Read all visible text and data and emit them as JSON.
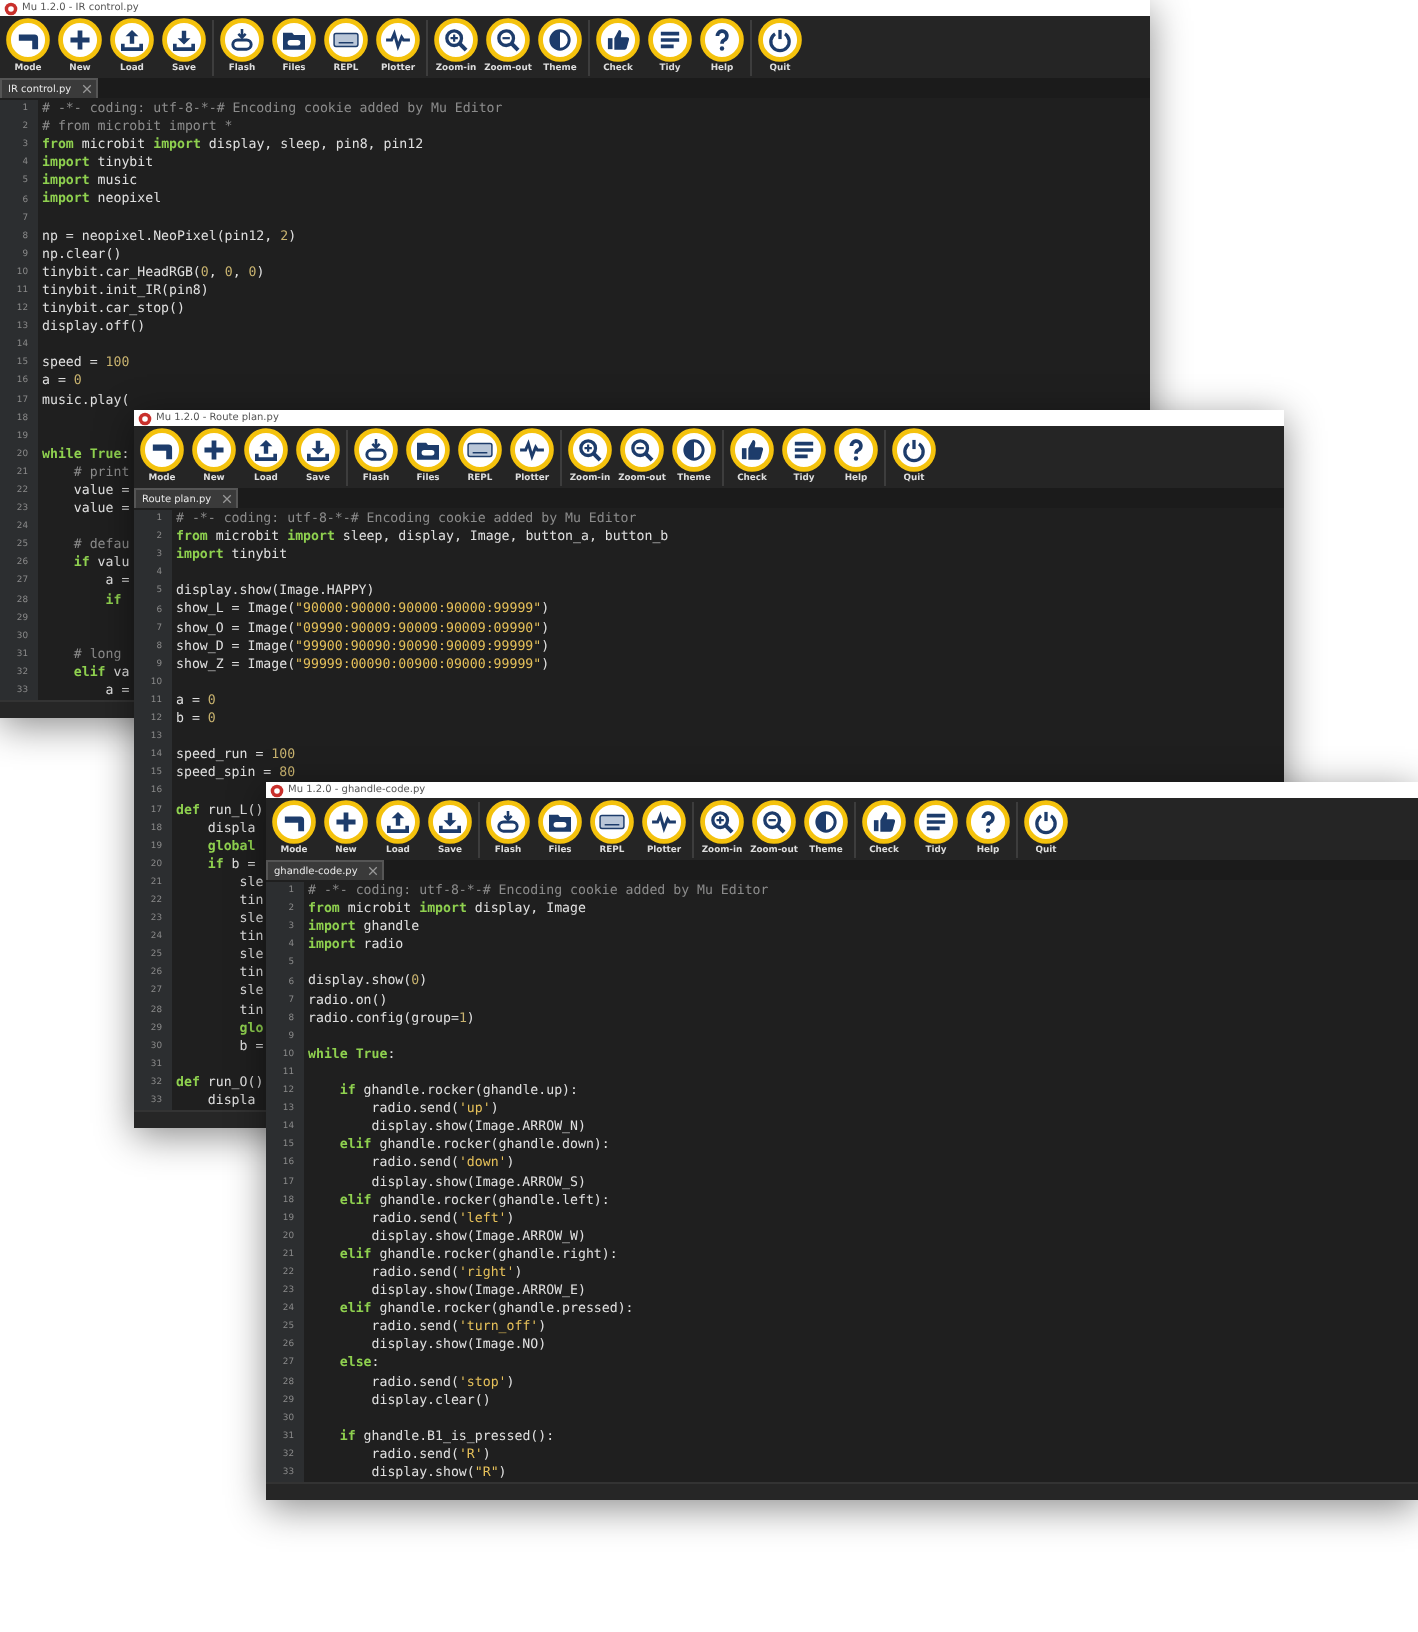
{
  "windows": [
    {
      "title": "Mu 1.2.0 - IR control.py",
      "toolbar_groups": [
        [
          "Mode",
          "New",
          "Load",
          "Save"
        ],
        [
          "Flash",
          "Files",
          "REPL",
          "Plotter"
        ],
        [
          "Zoom-in",
          "Zoom-out",
          "Theme"
        ],
        [
          "Check",
          "Tidy",
          "Help"
        ],
        [
          "Quit"
        ]
      ],
      "tab": {
        "label": "IR control.py"
      },
      "lines": [
        {
          "number": "1",
          "segments": [
            {
              "kind": "comment",
              "text": "# -*- coding: utf-8-*-# Encoding cookie added by Mu Editor"
            }
          ]
        },
        {
          "number": "2",
          "segments": [
            {
              "kind": "comment",
              "text": "# from microbit import *"
            }
          ]
        },
        {
          "number": "3",
          "segments": [
            {
              "kind": "keyword",
              "text": "from"
            },
            {
              "kind": "plain",
              "text": " microbit "
            },
            {
              "kind": "keyword",
              "text": "import"
            },
            {
              "kind": "plain",
              "text": " display, sleep, pin8, pin12"
            }
          ]
        },
        {
          "number": "4",
          "segments": [
            {
              "kind": "keyword",
              "text": "import"
            },
            {
              "kind": "plain",
              "text": " tinybit"
            }
          ]
        },
        {
          "number": "5",
          "segments": [
            {
              "kind": "keyword",
              "text": "import"
            },
            {
              "kind": "plain",
              "text": " music"
            }
          ]
        },
        {
          "number": "6",
          "segments": [
            {
              "kind": "keyword",
              "text": "import"
            },
            {
              "kind": "plain",
              "text": " neopixel"
            }
          ]
        },
        {
          "number": "7"
        },
        {
          "number": "8",
          "segments": [
            {
              "kind": "plain",
              "text": "np = neopixel.NeoPixel(pin12, "
            },
            {
              "kind": "number",
              "text": "2"
            },
            {
              "kind": "plain",
              "text": ")"
            }
          ]
        },
        {
          "number": "9",
          "segments": [
            {
              "kind": "plain",
              "text": "np.clear()"
            }
          ]
        },
        {
          "number": "10",
          "segments": [
            {
              "kind": "plain",
              "text": "tinybit.car_HeadRGB("
            },
            {
              "kind": "number",
              "text": "0"
            },
            {
              "kind": "plain",
              "text": ", "
            },
            {
              "kind": "number",
              "text": "0"
            },
            {
              "kind": "plain",
              "text": ", "
            },
            {
              "kind": "number",
              "text": "0"
            },
            {
              "kind": "plain",
              "text": ")"
            }
          ]
        },
        {
          "number": "11",
          "segments": [
            {
              "kind": "plain",
              "text": "tinybit.init_IR(pin8)"
            }
          ]
        },
        {
          "number": "12",
          "segments": [
            {
              "kind": "plain",
              "text": "tinybit.car_stop()"
            }
          ]
        },
        {
          "number": "13",
          "segments": [
            {
              "kind": "plain",
              "text": "display.off()"
            }
          ]
        },
        {
          "number": "14"
        },
        {
          "number": "15",
          "segments": [
            {
              "kind": "plain",
              "text": "speed = "
            },
            {
              "kind": "number",
              "text": "100"
            }
          ]
        },
        {
          "number": "16",
          "segments": [
            {
              "kind": "plain",
              "text": "a = "
            },
            {
              "kind": "number",
              "text": "0"
            }
          ]
        },
        {
          "number": "17",
          "segments": [
            {
              "kind": "plain",
              "text": "music.play("
            }
          ]
        },
        {
          "number": "18"
        },
        {
          "number": "19"
        },
        {
          "number": "20",
          "segments": [
            {
              "kind": "keyword",
              "text": "while True"
            },
            {
              "kind": "plain",
              "text": ":"
            }
          ]
        },
        {
          "number": "21",
          "segments": [
            {
              "kind": "comment",
              "text": "    # print"
            }
          ]
        },
        {
          "number": "22",
          "segments": [
            {
              "kind": "plain",
              "text": "    value ="
            }
          ]
        },
        {
          "number": "23",
          "segments": [
            {
              "kind": "plain",
              "text": "    value ="
            }
          ]
        },
        {
          "number": "24"
        },
        {
          "number": "25",
          "segments": [
            {
              "kind": "comment",
              "text": "    # defau"
            }
          ]
        },
        {
          "number": "26",
          "segments": [
            {
              "kind": "keyword",
              "text": "    if"
            },
            {
              "kind": "plain",
              "text": " valu"
            }
          ]
        },
        {
          "number": "27",
          "segments": [
            {
              "kind": "plain",
              "text": "        a ="
            }
          ]
        },
        {
          "number": "28",
          "segments": [
            {
              "kind": "keyword",
              "text": "        if"
            }
          ]
        },
        {
          "number": "29"
        },
        {
          "number": "30"
        },
        {
          "number": "31",
          "segments": [
            {
              "kind": "comment",
              "text": "    # long"
            }
          ]
        },
        {
          "number": "32",
          "segments": [
            {
              "kind": "keyword",
              "text": "    elif"
            },
            {
              "kind": "plain",
              "text": " va"
            }
          ]
        },
        {
          "number": "33",
          "segments": [
            {
              "kind": "plain",
              "text": "        a ="
            }
          ]
        }
      ]
    },
    {
      "title": "Mu 1.2.0 - Route plan.py",
      "toolbar_groups": [
        [
          "Mode",
          "New",
          "Load",
          "Save"
        ],
        [
          "Flash",
          "Files",
          "REPL",
          "Plotter"
        ],
        [
          "Zoom-in",
          "Zoom-out",
          "Theme"
        ],
        [
          "Check",
          "Tidy",
          "Help"
        ],
        [
          "Quit"
        ]
      ],
      "tab": {
        "label": "Route plan.py"
      },
      "lines": [
        {
          "number": "1",
          "segments": [
            {
              "kind": "comment",
              "text": "# -*- coding: utf-8-*-# Encoding cookie added by Mu Editor"
            }
          ]
        },
        {
          "number": "2",
          "segments": [
            {
              "kind": "keyword",
              "text": "from"
            },
            {
              "kind": "plain",
              "text": " microbit "
            },
            {
              "kind": "keyword",
              "text": "import"
            },
            {
              "kind": "plain",
              "text": " sleep, display, Image, button_a, button_b"
            }
          ]
        },
        {
          "number": "3",
          "segments": [
            {
              "kind": "keyword",
              "text": "import"
            },
            {
              "kind": "plain",
              "text": " tinybit"
            }
          ]
        },
        {
          "number": "4"
        },
        {
          "number": "5",
          "segments": [
            {
              "kind": "plain",
              "text": "display.show(Image.HAPPY)"
            }
          ]
        },
        {
          "number": "6",
          "segments": [
            {
              "kind": "plain",
              "text": "show_L = Image("
            },
            {
              "kind": "string",
              "text": "\"90000:90000:90000:90000:99999\""
            },
            {
              "kind": "plain",
              "text": ")"
            }
          ]
        },
        {
          "number": "7",
          "segments": [
            {
              "kind": "plain",
              "text": "show_O = Image("
            },
            {
              "kind": "string",
              "text": "\"09990:90009:90009:90009:09990\""
            },
            {
              "kind": "plain",
              "text": ")"
            }
          ]
        },
        {
          "number": "8",
          "segments": [
            {
              "kind": "plain",
              "text": "show_D = Image("
            },
            {
              "kind": "string",
              "text": "\"99900:90090:90090:90009:99999\""
            },
            {
              "kind": "plain",
              "text": ")"
            }
          ]
        },
        {
          "number": "9",
          "segments": [
            {
              "kind": "plain",
              "text": "show_Z = Image("
            },
            {
              "kind": "string",
              "text": "\"99999:00090:00900:09000:99999\""
            },
            {
              "kind": "plain",
              "text": ")"
            }
          ]
        },
        {
          "number": "10"
        },
        {
          "number": "11",
          "segments": [
            {
              "kind": "plain",
              "text": "a = "
            },
            {
              "kind": "number",
              "text": "0"
            }
          ]
        },
        {
          "number": "12",
          "segments": [
            {
              "kind": "plain",
              "text": "b = "
            },
            {
              "kind": "number",
              "text": "0"
            }
          ]
        },
        {
          "number": "13"
        },
        {
          "number": "14",
          "segments": [
            {
              "kind": "plain",
              "text": "speed_run = "
            },
            {
              "kind": "number",
              "text": "100"
            }
          ]
        },
        {
          "number": "15",
          "segments": [
            {
              "kind": "plain",
              "text": "speed_spin = "
            },
            {
              "kind": "number",
              "text": "80"
            }
          ]
        },
        {
          "number": "16"
        },
        {
          "number": "17",
          "segments": [
            {
              "kind": "keyword",
              "text": "def"
            },
            {
              "kind": "plain",
              "text": " run_L()"
            }
          ]
        },
        {
          "number": "18",
          "segments": [
            {
              "kind": "plain",
              "text": "    displa"
            }
          ]
        },
        {
          "number": "19",
          "segments": [
            {
              "kind": "keyword",
              "text": "    global"
            }
          ]
        },
        {
          "number": "20",
          "segments": [
            {
              "kind": "keyword",
              "text": "    if"
            },
            {
              "kind": "plain",
              "text": " b ="
            }
          ]
        },
        {
          "number": "21",
          "segments": [
            {
              "kind": "plain",
              "text": "        sle"
            }
          ]
        },
        {
          "number": "22",
          "segments": [
            {
              "kind": "plain",
              "text": "        tin"
            }
          ]
        },
        {
          "number": "23",
          "segments": [
            {
              "kind": "plain",
              "text": "        sle"
            }
          ]
        },
        {
          "number": "24",
          "segments": [
            {
              "kind": "plain",
              "text": "        tin"
            }
          ]
        },
        {
          "number": "25",
          "segments": [
            {
              "kind": "plain",
              "text": "        sle"
            }
          ]
        },
        {
          "number": "26",
          "segments": [
            {
              "kind": "plain",
              "text": "        tin"
            }
          ]
        },
        {
          "number": "27",
          "segments": [
            {
              "kind": "plain",
              "text": "        sle"
            }
          ]
        },
        {
          "number": "28",
          "segments": [
            {
              "kind": "plain",
              "text": "        tin"
            }
          ]
        },
        {
          "number": "29",
          "segments": [
            {
              "kind": "keyword",
              "text": "        glo"
            }
          ]
        },
        {
          "number": "30",
          "segments": [
            {
              "kind": "plain",
              "text": "        b ="
            }
          ]
        },
        {
          "number": "31"
        },
        {
          "number": "32",
          "segments": [
            {
              "kind": "keyword",
              "text": "def"
            },
            {
              "kind": "plain",
              "text": " run_O()"
            }
          ]
        },
        {
          "number": "33",
          "segments": [
            {
              "kind": "plain",
              "text": "    displa"
            }
          ]
        }
      ]
    },
    {
      "title": "Mu 1.2.0 - ghandle-code.py",
      "toolbar_groups": [
        [
          "Mode",
          "New",
          "Load",
          "Save"
        ],
        [
          "Flash",
          "Files",
          "REPL",
          "Plotter"
        ],
        [
          "Zoom-in",
          "Zoom-out",
          "Theme"
        ],
        [
          "Check",
          "Tidy",
          "Help"
        ],
        [
          "Quit"
        ]
      ],
      "tab": {
        "label": "ghandle-code.py"
      },
      "lines": [
        {
          "number": "1",
          "segments": [
            {
              "kind": "comment",
              "text": "# -*- coding: utf-8-*-# Encoding cookie added by Mu Editor"
            }
          ]
        },
        {
          "number": "2",
          "segments": [
            {
              "kind": "keyword",
              "text": "from"
            },
            {
              "kind": "plain",
              "text": " microbit "
            },
            {
              "kind": "keyword",
              "text": "import"
            },
            {
              "kind": "plain",
              "text": " display, Image"
            }
          ]
        },
        {
          "number": "3",
          "segments": [
            {
              "kind": "keyword",
              "text": "import"
            },
            {
              "kind": "plain",
              "text": " ghandle"
            }
          ]
        },
        {
          "number": "4",
          "segments": [
            {
              "kind": "keyword",
              "text": "import"
            },
            {
              "kind": "plain",
              "text": " radio"
            }
          ]
        },
        {
          "number": "5"
        },
        {
          "number": "6",
          "segments": [
            {
              "kind": "plain",
              "text": "display.show("
            },
            {
              "kind": "number",
              "text": "0"
            },
            {
              "kind": "plain",
              "text": ")"
            }
          ]
        },
        {
          "number": "7",
          "segments": [
            {
              "kind": "plain",
              "text": "radio.on()"
            }
          ]
        },
        {
          "number": "8",
          "segments": [
            {
              "kind": "plain",
              "text": "radio.config(group="
            },
            {
              "kind": "number",
              "text": "1"
            },
            {
              "kind": "plain",
              "text": ")"
            }
          ]
        },
        {
          "number": "9"
        },
        {
          "number": "10",
          "segments": [
            {
              "kind": "keyword",
              "text": "while True"
            },
            {
              "kind": "plain",
              "text": ":"
            }
          ]
        },
        {
          "number": "11"
        },
        {
          "number": "12",
          "segments": [
            {
              "kind": "keyword",
              "text": "    if"
            },
            {
              "kind": "plain",
              "text": " ghandle.rocker(ghandle.up):"
            }
          ]
        },
        {
          "number": "13",
          "segments": [
            {
              "kind": "plain",
              "text": "        radio.send("
            },
            {
              "kind": "string",
              "text": "'up'"
            },
            {
              "kind": "plain",
              "text": ")"
            }
          ]
        },
        {
          "number": "14",
          "segments": [
            {
              "kind": "plain",
              "text": "        display.show(Image.ARROW_N)"
            }
          ]
        },
        {
          "number": "15",
          "segments": [
            {
              "kind": "keyword",
              "text": "    elif"
            },
            {
              "kind": "plain",
              "text": " ghandle.rocker(ghandle.down):"
            }
          ]
        },
        {
          "number": "16",
          "segments": [
            {
              "kind": "plain",
              "text": "        radio.send("
            },
            {
              "kind": "string",
              "text": "'down'"
            },
            {
              "kind": "plain",
              "text": ")"
            }
          ]
        },
        {
          "number": "17",
          "segments": [
            {
              "kind": "plain",
              "text": "        display.show(Image.ARROW_S)"
            }
          ]
        },
        {
          "number": "18",
          "segments": [
            {
              "kind": "keyword",
              "text": "    elif"
            },
            {
              "kind": "plain",
              "text": " ghandle.rocker(ghandle.left):"
            }
          ]
        },
        {
          "number": "19",
          "segments": [
            {
              "kind": "plain",
              "text": "        radio.send("
            },
            {
              "kind": "string",
              "text": "'left'"
            },
            {
              "kind": "plain",
              "text": ")"
            }
          ]
        },
        {
          "number": "20",
          "segments": [
            {
              "kind": "plain",
              "text": "        display.show(Image.ARROW_W)"
            }
          ]
        },
        {
          "number": "21",
          "segments": [
            {
              "kind": "keyword",
              "text": "    elif"
            },
            {
              "kind": "plain",
              "text": " ghandle.rocker(ghandle.right):"
            }
          ]
        },
        {
          "number": "22",
          "segments": [
            {
              "kind": "plain",
              "text": "        radio.send("
            },
            {
              "kind": "string",
              "text": "'right'"
            },
            {
              "kind": "plain",
              "text": ")"
            }
          ]
        },
        {
          "number": "23",
          "segments": [
            {
              "kind": "plain",
              "text": "        display.show(Image.ARROW_E)"
            }
          ]
        },
        {
          "number": "24",
          "segments": [
            {
              "kind": "keyword",
              "text": "    elif"
            },
            {
              "kind": "plain",
              "text": " ghandle.rocker(ghandle.pressed):"
            }
          ]
        },
        {
          "number": "25",
          "segments": [
            {
              "kind": "plain",
              "text": "        radio.send("
            },
            {
              "kind": "string",
              "text": "'turn_off'"
            },
            {
              "kind": "plain",
              "text": ")"
            }
          ]
        },
        {
          "number": "26",
          "segments": [
            {
              "kind": "plain",
              "text": "        display.show(Image.NO)"
            }
          ]
        },
        {
          "number": "27",
          "segments": [
            {
              "kind": "keyword",
              "text": "    else"
            },
            {
              "kind": "plain",
              "text": ":"
            }
          ]
        },
        {
          "number": "28",
          "segments": [
            {
              "kind": "plain",
              "text": "        radio.send("
            },
            {
              "kind": "string",
              "text": "'stop'"
            },
            {
              "kind": "plain",
              "text": ")"
            }
          ]
        },
        {
          "number": "29",
          "segments": [
            {
              "kind": "plain",
              "text": "        display.clear()"
            }
          ]
        },
        {
          "number": "30"
        },
        {
          "number": "31",
          "segments": [
            {
              "kind": "keyword",
              "text": "    if"
            },
            {
              "kind": "plain",
              "text": " ghandle.B1_is_pressed():"
            }
          ]
        },
        {
          "number": "32",
          "segments": [
            {
              "kind": "plain",
              "text": "        radio.send("
            },
            {
              "kind": "string",
              "text": "'R'"
            },
            {
              "kind": "plain",
              "text": ")"
            }
          ]
        },
        {
          "number": "33",
          "segments": [
            {
              "kind": "plain",
              "text": "        display.show("
            },
            {
              "kind": "string",
              "text": "\"R\""
            },
            {
              "kind": "plain",
              "text": ")"
            }
          ]
        }
      ]
    }
  ]
}
